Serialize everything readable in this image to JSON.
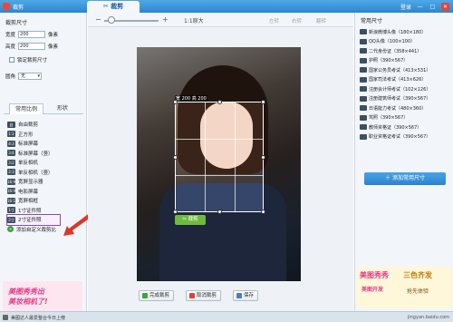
{
  "titlebar": {
    "title": "裁剪",
    "tab": "裁剪",
    "login": "登录",
    "controls": [
      "—",
      "□",
      "✕"
    ]
  },
  "left": {
    "size_title": "裁剪尺寸",
    "width": {
      "label": "宽度",
      "value": "200",
      "unit": "像素"
    },
    "height": {
      "label": "高度",
      "value": "200",
      "unit": "像素"
    },
    "lock_label": "锁定裁剪尺寸",
    "shape_label": "圆角",
    "shape_value": "无",
    "tabs": [
      "常用比例",
      "形状"
    ],
    "ratios": [
      "自由裁剪",
      "正方形",
      "标准屏幕",
      "标准屏幕（竖）",
      "单反相机",
      "单反相机（竖）",
      "宽屏显示器",
      "电影屏幕",
      "宽屏相框",
      "1寸证件照",
      "2寸证件照",
      "添加自定义裁剪比"
    ],
    "ratio_icons": [
      "自",
      "1:1",
      "4:3",
      "3:4",
      "3:2",
      "2:3",
      "16:9",
      "16:9",
      "16:10",
      "1寸",
      "2寸",
      "+"
    ],
    "promo": [
      "美图秀秀出",
      "美妆相机了!"
    ]
  },
  "toolbar": {
    "zoom_minus": "−",
    "zoom_plus": "+",
    "ratio_label": "1:1原大",
    "rotate": "左转",
    "rotate2": "右转",
    "flip": "翻转"
  },
  "canvas": {
    "dim_label": "宽 200 高 200",
    "crop_button": "裁剪"
  },
  "bottom": {
    "done": "完成裁剪",
    "cancel": "取消裁剪",
    "save": "保存"
  },
  "right": {
    "title": "常用尺寸",
    "presets": [
      "新浪微博头像（180×180）",
      "QQ头像（100×100）",
      "二代身份证（358×441）",
      "护照（390×567）",
      "国家公务员考试（413×531）",
      "国家司法考试（413×626）",
      "注册会计师考试（102×126）",
      "注册建筑师考试（390×567）",
      "日语能力考试（480×360）",
      "驾照（390×567）",
      "教师资格证（390×567）",
      "职业资格证考试（390×567）"
    ],
    "add_preset": "＋ 添加常用尺寸",
    "promo": {
      "a": "美图秀秀",
      "b": "三色齐发",
      "c": "美图开发",
      "d": "抢先体验"
    }
  },
  "status": {
    "text": "美图达人最爱整合今日上榜",
    "site": "jingyan.baidu.com"
  },
  "watermark": "S中"
}
